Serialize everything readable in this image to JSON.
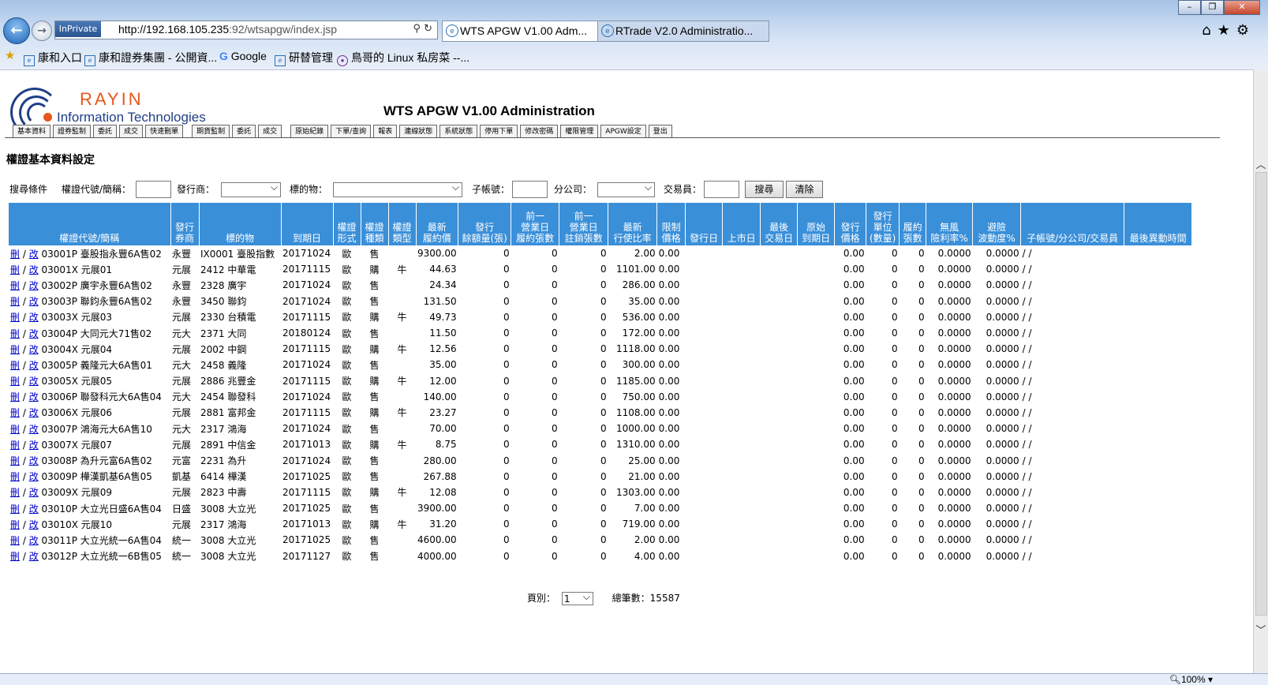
{
  "browser": {
    "inprivate": "InPrivate",
    "url_host": "http://192.168.105.235",
    "url_path": ":92/wtsapgw/index.jsp",
    "tabs": [
      {
        "title": "WTS APGW V1.00 Adm...",
        "close": "✕"
      },
      {
        "title": "RTrade V2.0 Administratio..."
      }
    ],
    "favorites": [
      "康和入口",
      "康和證券集團 - 公開資...",
      "Google",
      "研替管理",
      "鳥哥的 Linux 私房菜 --..."
    ],
    "zoom": "100%"
  },
  "header": {
    "brand_top": "RAYIN",
    "brand_bottom": "Information Technologies",
    "title": "WTS APGW V1.00 Administration"
  },
  "menu": {
    "group1": [
      "基本資料",
      "證券監制",
      "委託",
      "成交",
      "快速刪單"
    ],
    "group2": [
      "期貨監制",
      "委託",
      "成交"
    ],
    "group3": [
      "原始紀錄",
      "下單/查詢",
      "報表",
      "連線狀態",
      "系統狀態",
      "停用下單",
      "修改密碼",
      "權限管理",
      "APGW設定",
      "登出"
    ]
  },
  "section_title": "權證基本資料設定",
  "search": {
    "criteria_label": "搜尋條件",
    "code_label": "權證代號/簡稱：",
    "issuer_label": "發行商：",
    "underlying_label": "標的物：",
    "subaccount_label": "子帳號：",
    "branch_label": "分公司：",
    "trader_label": "交易員：",
    "search_button": "搜尋",
    "clear_button": "清除"
  },
  "table": {
    "headers": [
      "權證代號/簡稱",
      "發行\n券商",
      "標的物",
      "到期日",
      "權證\n形式",
      "權證\n種類",
      "權證\n類型",
      "最新\n履約價",
      "發行\n餘額量(張)",
      "前一\n營業日\n履約張數",
      "前一\n營業日\n註銷張數",
      "最新\n行使比率",
      "限制\n價格",
      "發行日",
      "上市日",
      "最後\n交易日",
      "原始\n到期日",
      "發行\n價格",
      "發行\n單位\n(數量)",
      "履約\n張數",
      "無風\n險利率%",
      "避險\n波動度%",
      "子帳號/分公司/交易員",
      "最後異動時間"
    ],
    "delete_label": "刪",
    "edit_label": "改",
    "rows": [
      [
        "03001P 臺股指永豐6A售02",
        "永豐",
        "IX0001 臺股指數",
        "20171024",
        "歐",
        "售",
        "",
        "9300.00",
        "0",
        "0",
        "0",
        "2.00",
        "0.00",
        "",
        "",
        "",
        "",
        "0.00",
        "0",
        "0",
        "0.0000",
        "0.0000",
        "/ /",
        ""
      ],
      [
        "03001X 元展01",
        "元展",
        "2412 中華電",
        "20171115",
        "歐",
        "購",
        "牛",
        "44.63",
        "0",
        "0",
        "0",
        "1101.00",
        "0.00",
        "",
        "",
        "",
        "",
        "0.00",
        "0",
        "0",
        "0.0000",
        "0.0000",
        "/ /",
        ""
      ],
      [
        "03002P 廣宇永豐6A售02",
        "永豐",
        "2328 廣宇",
        "20171024",
        "歐",
        "售",
        "",
        "24.34",
        "0",
        "0",
        "0",
        "286.00",
        "0.00",
        "",
        "",
        "",
        "",
        "0.00",
        "0",
        "0",
        "0.0000",
        "0.0000",
        "/ /",
        ""
      ],
      [
        "03003P 聯鈞永豐6A售02",
        "永豐",
        "3450 聯鈞",
        "20171024",
        "歐",
        "售",
        "",
        "131.50",
        "0",
        "0",
        "0",
        "35.00",
        "0.00",
        "",
        "",
        "",
        "",
        "0.00",
        "0",
        "0",
        "0.0000",
        "0.0000",
        "/ /",
        ""
      ],
      [
        "03003X 元展03",
        "元展",
        "2330 台積電",
        "20171115",
        "歐",
        "購",
        "牛",
        "49.73",
        "0",
        "0",
        "0",
        "536.00",
        "0.00",
        "",
        "",
        "",
        "",
        "0.00",
        "0",
        "0",
        "0.0000",
        "0.0000",
        "/ /",
        ""
      ],
      [
        "03004P 大同元大71售02",
        "元大",
        "2371 大同",
        "20180124",
        "歐",
        "售",
        "",
        "11.50",
        "0",
        "0",
        "0",
        "172.00",
        "0.00",
        "",
        "",
        "",
        "",
        "0.00",
        "0",
        "0",
        "0.0000",
        "0.0000",
        "/ /",
        ""
      ],
      [
        "03004X 元展04",
        "元展",
        "2002 中鋼",
        "20171115",
        "歐",
        "購",
        "牛",
        "12.56",
        "0",
        "0",
        "0",
        "1118.00",
        "0.00",
        "",
        "",
        "",
        "",
        "0.00",
        "0",
        "0",
        "0.0000",
        "0.0000",
        "/ /",
        ""
      ],
      [
        "03005P 義隆元大6A售01",
        "元大",
        "2458 義隆",
        "20171024",
        "歐",
        "售",
        "",
        "35.00",
        "0",
        "0",
        "0",
        "300.00",
        "0.00",
        "",
        "",
        "",
        "",
        "0.00",
        "0",
        "0",
        "0.0000",
        "0.0000",
        "/ /",
        ""
      ],
      [
        "03005X 元展05",
        "元展",
        "2886 兆豐金",
        "20171115",
        "歐",
        "購",
        "牛",
        "12.00",
        "0",
        "0",
        "0",
        "1185.00",
        "0.00",
        "",
        "",
        "",
        "",
        "0.00",
        "0",
        "0",
        "0.0000",
        "0.0000",
        "/ /",
        ""
      ],
      [
        "03006P 聯發科元大6A售04",
        "元大",
        "2454 聯發科",
        "20171024",
        "歐",
        "售",
        "",
        "140.00",
        "0",
        "0",
        "0",
        "750.00",
        "0.00",
        "",
        "",
        "",
        "",
        "0.00",
        "0",
        "0",
        "0.0000",
        "0.0000",
        "/ /",
        ""
      ],
      [
        "03006X 元展06",
        "元展",
        "2881 富邦金",
        "20171115",
        "歐",
        "購",
        "牛",
        "23.27",
        "0",
        "0",
        "0",
        "1108.00",
        "0.00",
        "",
        "",
        "",
        "",
        "0.00",
        "0",
        "0",
        "0.0000",
        "0.0000",
        "/ /",
        ""
      ],
      [
        "03007P 鴻海元大6A售10",
        "元大",
        "2317 鴻海",
        "20171024",
        "歐",
        "售",
        "",
        "70.00",
        "0",
        "0",
        "0",
        "1000.00",
        "0.00",
        "",
        "",
        "",
        "",
        "0.00",
        "0",
        "0",
        "0.0000",
        "0.0000",
        "/ /",
        ""
      ],
      [
        "03007X 元展07",
        "元展",
        "2891 中信金",
        "20171013",
        "歐",
        "購",
        "牛",
        "8.75",
        "0",
        "0",
        "0",
        "1310.00",
        "0.00",
        "",
        "",
        "",
        "",
        "0.00",
        "0",
        "0",
        "0.0000",
        "0.0000",
        "/ /",
        ""
      ],
      [
        "03008P 為升元富6A售02",
        "元富",
        "2231 為升",
        "20171024",
        "歐",
        "售",
        "",
        "280.00",
        "0",
        "0",
        "0",
        "25.00",
        "0.00",
        "",
        "",
        "",
        "",
        "0.00",
        "0",
        "0",
        "0.0000",
        "0.0000",
        "/ /",
        ""
      ],
      [
        "03009P 樺漢凱基6A售05",
        "凱基",
        "6414 樺漢",
        "20171025",
        "歐",
        "售",
        "",
        "267.88",
        "0",
        "0",
        "0",
        "21.00",
        "0.00",
        "",
        "",
        "",
        "",
        "0.00",
        "0",
        "0",
        "0.0000",
        "0.0000",
        "/ /",
        ""
      ],
      [
        "03009X 元展09",
        "元展",
        "2823 中壽",
        "20171115",
        "歐",
        "購",
        "牛",
        "12.08",
        "0",
        "0",
        "0",
        "1303.00",
        "0.00",
        "",
        "",
        "",
        "",
        "0.00",
        "0",
        "0",
        "0.0000",
        "0.0000",
        "/ /",
        ""
      ],
      [
        "03010P 大立光日盛6A售04",
        "日盛",
        "3008 大立光",
        "20171025",
        "歐",
        "售",
        "",
        "3900.00",
        "0",
        "0",
        "0",
        "7.00",
        "0.00",
        "",
        "",
        "",
        "",
        "0.00",
        "0",
        "0",
        "0.0000",
        "0.0000",
        "/ /",
        ""
      ],
      [
        "03010X 元展10",
        "元展",
        "2317 鴻海",
        "20171013",
        "歐",
        "購",
        "牛",
        "31.20",
        "0",
        "0",
        "0",
        "719.00",
        "0.00",
        "",
        "",
        "",
        "",
        "0.00",
        "0",
        "0",
        "0.0000",
        "0.0000",
        "/ /",
        ""
      ],
      [
        "03011P 大立光統一6A售04",
        "統一",
        "3008 大立光",
        "20171025",
        "歐",
        "售",
        "",
        "4600.00",
        "0",
        "0",
        "0",
        "2.00",
        "0.00",
        "",
        "",
        "",
        "",
        "0.00",
        "0",
        "0",
        "0.0000",
        "0.0000",
        "/ /",
        ""
      ],
      [
        "03012P 大立光統一6B售05",
        "統一",
        "3008 大立光",
        "20171127",
        "歐",
        "售",
        "",
        "4000.00",
        "0",
        "0",
        "0",
        "4.00",
        "0.00",
        "",
        "",
        "",
        "",
        "0.00",
        "0",
        "0",
        "0.0000",
        "0.0000",
        "/ /",
        ""
      ]
    ]
  },
  "pager": {
    "page_label": "頁別：",
    "page_value": "1",
    "total_label": "總筆數：15587"
  }
}
